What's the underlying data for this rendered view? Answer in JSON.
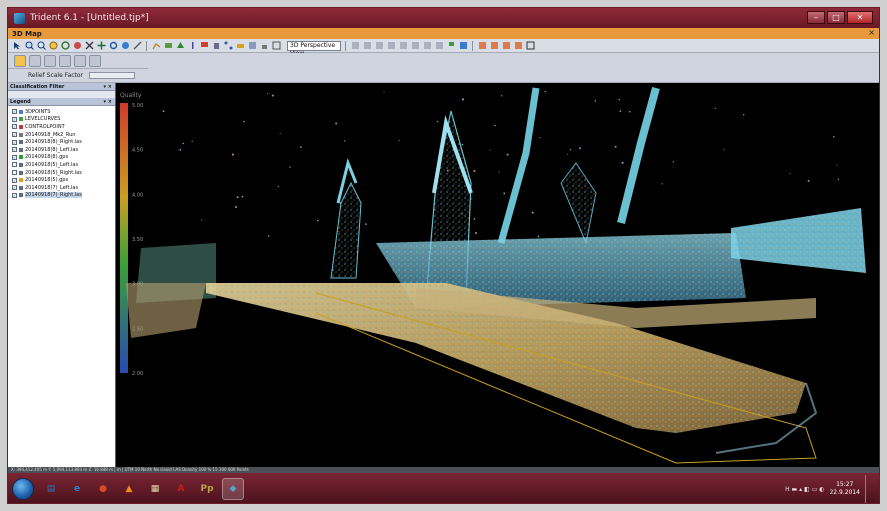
{
  "window": {
    "title": "Trident 6.1 - [Untitled.tjp*]",
    "minimize": "–",
    "maximize": "□",
    "close": "✕"
  },
  "map_tab": {
    "label": "3D Map",
    "close": "×"
  },
  "toolbar": {
    "view_mode": "3D Perspective View",
    "relief_label": "Relief Scale Factor"
  },
  "panels": {
    "classification_title": "Classification Filter",
    "legend_title": "Legend",
    "pin": "▾ ×"
  },
  "legend": {
    "items": [
      {
        "label": "3DPOINTS",
        "checked": true,
        "color": "#4a7cd0"
      },
      {
        "label": "LEVELCURVES",
        "checked": true,
        "color": "#3aa043"
      },
      {
        "label": "CONTROLPOINT",
        "checked": true,
        "color": "#c43a3a"
      },
      {
        "label": "20140918_Mk2_Run",
        "checked": true,
        "color": "#777777"
      },
      {
        "label": "20140918(8)_Right.las",
        "checked": true,
        "color": "#5d6a88"
      },
      {
        "label": "20140918(8)_Left.las",
        "checked": true,
        "color": "#5d6a88"
      },
      {
        "label": "20140918(8).gps",
        "checked": true,
        "color": "#2aa03a"
      },
      {
        "label": "20140918(5)_Left.las",
        "checked": false,
        "color": "#5d6a88"
      },
      {
        "label": "20140918(5)_Right.las",
        "checked": false,
        "color": "#5d6a88"
      },
      {
        "label": "20140918(5).gps",
        "checked": true,
        "color": "#e0a020"
      },
      {
        "label": "20140918(7)_Left.las",
        "checked": true,
        "color": "#5d6a88"
      },
      {
        "label": "20140918(7)_Right.las",
        "checked": true,
        "color": "#5d6a88",
        "selected": true
      }
    ]
  },
  "colorbar": {
    "title": "Quality",
    "ticks": [
      "5.00",
      "4.50",
      "4.00",
      "3.50",
      "3.00",
      "2.50",
      "2.00"
    ]
  },
  "statusbar": {
    "text": "X: 394,412.405 m   Y: 5,094,113.893 m   Z: 16.848 m | m | UTM 10 North No Geoid          LAS Density 100 %   15 100 000 Points"
  },
  "taskbar": {
    "apps": [
      {
        "name": "explorer",
        "glyph": "▤",
        "color": "#3a6fb5"
      },
      {
        "name": "internet-explorer",
        "glyph": "e",
        "color": "#2a7fd4"
      },
      {
        "name": "chrome",
        "glyph": "●",
        "color": "#d94a2a"
      },
      {
        "name": "vlc",
        "glyph": "▲",
        "color": "#f08a1a"
      },
      {
        "name": "files",
        "glyph": "▦",
        "color": "#e6d8a8"
      },
      {
        "name": "acrobat",
        "glyph": "A",
        "color": "#c81e1e"
      },
      {
        "name": "powerpoint",
        "glyph": "Pp",
        "color": "#b5a24a"
      },
      {
        "name": "trident",
        "glyph": "◆",
        "color": "#5aa0c8"
      }
    ],
    "tray_icons": "H  ▬ ▴ ◧ ▭ ◐",
    "time": "15:27",
    "date": "22.9.2014"
  }
}
